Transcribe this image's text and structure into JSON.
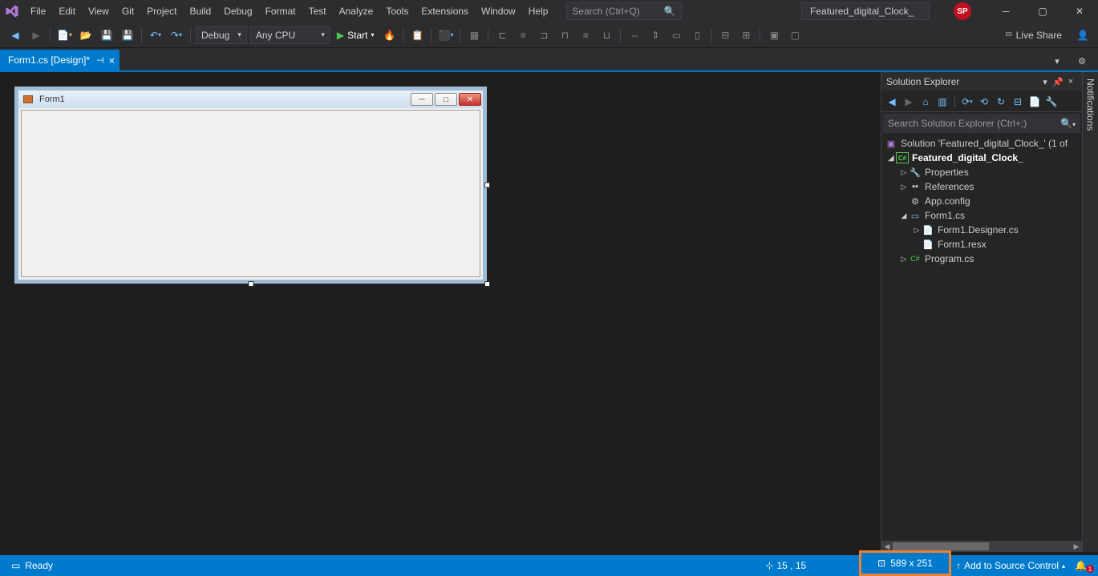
{
  "menu": [
    "File",
    "Edit",
    "View",
    "Git",
    "Project",
    "Build",
    "Debug",
    "Format",
    "Test",
    "Analyze",
    "Tools",
    "Extensions",
    "Window",
    "Help"
  ],
  "search": {
    "placeholder": "Search (Ctrl+Q)"
  },
  "projectName": "Featured_digital_Clock_",
  "userInitials": "SP",
  "toolbar": {
    "config": "Debug",
    "platform": "Any CPU",
    "start": "Start",
    "liveShare": "Live Share"
  },
  "docTab": {
    "title": "Form1.cs [Design]*"
  },
  "designerForm": {
    "title": "Form1"
  },
  "solutionExplorer": {
    "title": "Solution Explorer",
    "searchPlaceholder": "Search Solution Explorer (Ctrl+;)",
    "tree": {
      "solution": "Solution 'Featured_digital_Clock_' (1 of",
      "project": "Featured_digital_Clock_",
      "properties": "Properties",
      "references": "References",
      "appconfig": "App.config",
      "form1": "Form1.cs",
      "designer": "Form1.Designer.cs",
      "resx": "Form1.resx",
      "program": "Program.cs"
    }
  },
  "notifications": "Notifications",
  "statusbar": {
    "ready": "Ready",
    "position": "15 , 15",
    "size": "589 x 251",
    "sourceControl": "Add to Source Control",
    "notifCount": "1"
  }
}
